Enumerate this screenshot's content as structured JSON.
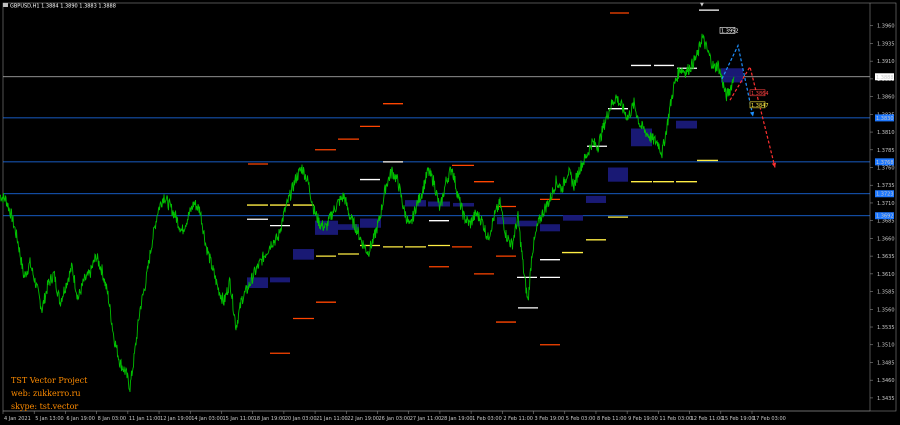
{
  "header": {
    "text": "GBPUSD,H1  1.3884 1.3890 1.3883 1.3888"
  },
  "promo": {
    "line1": "TST Vector Project",
    "line2": "web: zukkerro.ru",
    "line3": "skype: tst.vector"
  },
  "colors": {
    "background": "#000000",
    "price": "#00c000",
    "levelBlue": "#1e78ff",
    "levelGray": "#c0c0c0",
    "zone": "#1a1a7a",
    "marker_white": "#ffffff",
    "marker_red": "#ff4500",
    "marker_yellow": "#ffee44",
    "arrowBlue": "#1e90ff",
    "arrowRed": "#ff3030"
  },
  "chart_data": {
    "type": "line",
    "title": "",
    "symbol": "GBPUSD",
    "timeframe": "H1",
    "ylim": [
      1.3425,
      1.3985
    ],
    "yticks": [
      "1.3960",
      "1.3935",
      "1.3910",
      "1.3885",
      "1.3860",
      "1.3835",
      "1.3810",
      "1.3785",
      "1.3760",
      "1.3735",
      "1.3710",
      "1.3685",
      "1.3660",
      "1.3635",
      "1.3610",
      "1.3585",
      "1.3560",
      "1.3535",
      "1.3510",
      "1.3485",
      "1.3460",
      "1.3435"
    ],
    "xticks": [
      "4 Jan 2021",
      "5 Jan 13:00",
      "6 Jan 19:00",
      "8 Jan 03:00",
      "11 Jan 11:00",
      "12 Jan 19:00",
      "14 Jan 03:00",
      "15 Jan 11:00",
      "18 Jan 19:00",
      "20 Jan 03:00",
      "21 Jan 11:00",
      "22 Jan 19:00",
      "26 Jan 03:00",
      "27 Jan 11:00",
      "28 Jan 19:00",
      "1 Feb 03:00",
      "2 Feb 11:00",
      "3 Feb 19:00",
      "5 Feb 03:00",
      "8 Feb 11:00",
      "9 Feb 19:00",
      "11 Feb 03:00",
      "12 Feb 11:00",
      "15 Feb 19:00",
      "17 Feb 03:00"
    ],
    "current_price": "1.3888",
    "price_labels": [
      {
        "value": "1.3830",
        "kind": "blue"
      },
      {
        "value": "1.3768",
        "kind": "blue"
      },
      {
        "value": "1.3723",
        "kind": "blue"
      },
      {
        "value": "1.3692",
        "kind": "blue"
      }
    ],
    "horizontal_levels": [
      {
        "price": 1.3888,
        "kind": "gray"
      },
      {
        "price": 1.383,
        "kind": "blue"
      },
      {
        "price": 1.3768,
        "kind": "blue"
      },
      {
        "price": 1.3723,
        "kind": "blue"
      },
      {
        "price": 1.3692,
        "kind": "blue"
      }
    ],
    "box_labels": [
      "1.3952",
      "1.3864",
      "1.3847"
    ],
    "series": [
      {
        "name": "",
        "keypoints": [
          [
            0,
            1.372
          ],
          [
            6,
            1.3715
          ],
          [
            12,
            1.369
          ],
          [
            18,
            1.3655
          ],
          [
            24,
            1.3605
          ],
          [
            30,
            1.3625
          ],
          [
            36,
            1.3595
          ],
          [
            42,
            1.356
          ],
          [
            48,
            1.3595
          ],
          [
            54,
            1.361
          ],
          [
            60,
            1.357
          ],
          [
            66,
            1.3595
          ],
          [
            72,
            1.362
          ],
          [
            78,
            1.3575
          ],
          [
            84,
            1.36
          ],
          [
            90,
            1.361
          ],
          [
            96,
            1.3635
          ],
          [
            102,
            1.3615
          ],
          [
            108,
            1.358
          ],
          [
            114,
            1.352
          ],
          [
            120,
            1.3485
          ],
          [
            126,
            1.347
          ],
          [
            130,
            1.345
          ],
          [
            134,
            1.349
          ],
          [
            140,
            1.356
          ],
          [
            146,
            1.36
          ],
          [
            152,
            1.3655
          ],
          [
            158,
            1.37
          ],
          [
            164,
            1.372
          ],
          [
            170,
            1.3705
          ],
          [
            176,
            1.369
          ],
          [
            182,
            1.367
          ],
          [
            188,
            1.369
          ],
          [
            194,
            1.371
          ],
          [
            200,
            1.37
          ],
          [
            206,
            1.365
          ],
          [
            212,
            1.362
          ],
          [
            218,
            1.359
          ],
          [
            224,
            1.357
          ],
          [
            230,
            1.36
          ],
          [
            236,
            1.3535
          ],
          [
            242,
            1.3575
          ],
          [
            248,
            1.359
          ],
          [
            254,
            1.361
          ],
          [
            260,
            1.3625
          ],
          [
            266,
            1.364
          ],
          [
            272,
            1.3655
          ],
          [
            278,
            1.366
          ],
          [
            284,
            1.3695
          ],
          [
            290,
            1.372
          ],
          [
            296,
            1.3745
          ],
          [
            302,
            1.376
          ],
          [
            308,
            1.374
          ],
          [
            314,
            1.37
          ],
          [
            320,
            1.368
          ],
          [
            326,
            1.3675
          ],
          [
            332,
            1.3695
          ],
          [
            338,
            1.371
          ],
          [
            344,
            1.372
          ],
          [
            350,
            1.369
          ],
          [
            356,
            1.3675
          ],
          [
            362,
            1.3655
          ],
          [
            368,
            1.364
          ],
          [
            374,
            1.366
          ],
          [
            380,
            1.369
          ],
          [
            386,
            1.3735
          ],
          [
            392,
            1.3755
          ],
          [
            398,
            1.374
          ],
          [
            404,
            1.37
          ],
          [
            410,
            1.3675
          ],
          [
            416,
            1.3705
          ],
          [
            422,
            1.3725
          ],
          [
            428,
            1.3755
          ],
          [
            434,
            1.374
          ],
          [
            440,
            1.37
          ],
          [
            446,
            1.374
          ],
          [
            452,
            1.376
          ],
          [
            458,
            1.372
          ],
          [
            464,
            1.369
          ],
          [
            470,
            1.368
          ],
          [
            476,
            1.3695
          ],
          [
            482,
            1.3685
          ],
          [
            488,
            1.366
          ],
          [
            494,
            1.369
          ],
          [
            500,
            1.371
          ],
          [
            506,
            1.3665
          ],
          [
            512,
            1.365
          ],
          [
            518,
            1.369
          ],
          [
            524,
            1.361
          ],
          [
            528,
            1.357
          ],
          [
            532,
            1.364
          ],
          [
            538,
            1.368
          ],
          [
            544,
            1.37
          ],
          [
            550,
            1.3715
          ],
          [
            556,
            1.374
          ],
          [
            562,
            1.373
          ],
          [
            568,
            1.3755
          ],
          [
            574,
            1.3735
          ],
          [
            580,
            1.376
          ],
          [
            586,
            1.3775
          ],
          [
            592,
            1.3795
          ],
          [
            598,
            1.379
          ],
          [
            604,
            1.382
          ],
          [
            610,
            1.3845
          ],
          [
            616,
            1.386
          ],
          [
            622,
            1.3845
          ],
          [
            628,
            1.383
          ],
          [
            634,
            1.385
          ],
          [
            640,
            1.382
          ],
          [
            646,
            1.381
          ],
          [
            652,
            1.38
          ],
          [
            658,
            1.3795
          ],
          [
            662,
            1.378
          ],
          [
            666,
            1.381
          ],
          [
            670,
            1.3845
          ],
          [
            674,
            1.3875
          ],
          [
            680,
            1.39
          ],
          [
            686,
            1.3895
          ],
          [
            692,
            1.3905
          ],
          [
            698,
            1.392
          ],
          [
            702,
            1.3945
          ],
          [
            706,
            1.393
          ],
          [
            710,
            1.3915
          ],
          [
            714,
            1.39
          ],
          [
            718,
            1.3905
          ],
          [
            722,
            1.3885
          ],
          [
            726,
            1.386
          ],
          [
            730,
            1.387
          ],
          [
            734,
            1.3888
          ]
        ]
      }
    ],
    "zones": [
      {
        "x1": 247,
        "x2": 268,
        "p1": 1.3605,
        "p2": 1.359
      },
      {
        "x1": 270,
        "x2": 290,
        "p1": 1.3605,
        "p2": 1.3598
      },
      {
        "x1": 293,
        "x2": 314,
        "p1": 1.3645,
        "p2": 1.363
      },
      {
        "x1": 315,
        "x2": 338,
        "p1": 1.3685,
        "p2": 1.3665
      },
      {
        "x1": 338,
        "x2": 359,
        "p1": 1.368,
        "p2": 1.3672
      },
      {
        "x1": 360,
        "x2": 381,
        "p1": 1.3688,
        "p2": 1.3675
      },
      {
        "x1": 405,
        "x2": 426,
        "p1": 1.3714,
        "p2": 1.3705
      },
      {
        "x1": 428,
        "x2": 450,
        "p1": 1.3712,
        "p2": 1.3705
      },
      {
        "x1": 453,
        "x2": 474,
        "p1": 1.371,
        "p2": 1.3705
      },
      {
        "x1": 497,
        "x2": 516,
        "p1": 1.369,
        "p2": 1.368
      },
      {
        "x1": 517,
        "x2": 537,
        "p1": 1.3685,
        "p2": 1.3677
      },
      {
        "x1": 540,
        "x2": 560,
        "p1": 1.368,
        "p2": 1.367
      },
      {
        "x1": 563,
        "x2": 583,
        "p1": 1.3693,
        "p2": 1.3685
      },
      {
        "x1": 586,
        "x2": 606,
        "p1": 1.372,
        "p2": 1.371
      },
      {
        "x1": 608,
        "x2": 628,
        "p1": 1.376,
        "p2": 1.374
      },
      {
        "x1": 631,
        "x2": 652,
        "p1": 1.3815,
        "p2": 1.379
      },
      {
        "x1": 676,
        "x2": 697,
        "p1": 1.3826,
        "p2": 1.3815
      },
      {
        "x1": 721,
        "x2": 743,
        "p1": 1.39,
        "p2": 1.388
      }
    ],
    "markers": [
      {
        "x1": 610,
        "x2": 629,
        "p": 1.3978,
        "c": "red"
      },
      {
        "x1": 699,
        "x2": 719,
        "p": 1.3982,
        "c": "white"
      },
      {
        "x1": 631,
        "x2": 651,
        "p": 1.3904,
        "c": "white"
      },
      {
        "x1": 654,
        "x2": 674,
        "p": 1.3904,
        "c": "white"
      },
      {
        "x1": 677,
        "x2": 697,
        "p": 1.39,
        "c": "white"
      },
      {
        "x1": 587,
        "x2": 607,
        "p": 1.379,
        "c": "white"
      },
      {
        "x1": 608,
        "x2": 628,
        "p": 1.3843,
        "c": "white"
      },
      {
        "x1": 676,
        "x2": 697,
        "p": 1.374,
        "c": "yellow"
      },
      {
        "x1": 653,
        "x2": 674,
        "p": 1.374,
        "c": "yellow"
      },
      {
        "x1": 631,
        "x2": 652,
        "p": 1.374,
        "c": "yellow"
      },
      {
        "x1": 697,
        "x2": 718,
        "p": 1.377,
        "c": "yellow"
      },
      {
        "x1": 608,
        "x2": 628,
        "p": 1.369,
        "c": "yellow"
      },
      {
        "x1": 586,
        "x2": 606,
        "p": 1.3658,
        "c": "yellow"
      },
      {
        "x1": 562,
        "x2": 583,
        "p": 1.364,
        "c": "yellow"
      },
      {
        "x1": 540,
        "x2": 560,
        "p": 1.363,
        "c": "white"
      },
      {
        "x1": 540,
        "x2": 560,
        "p": 1.3605,
        "c": "white"
      },
      {
        "x1": 517,
        "x2": 537,
        "p": 1.3605,
        "c": "white"
      },
      {
        "x1": 383,
        "x2": 403,
        "p": 1.385,
        "c": "red"
      },
      {
        "x1": 360,
        "x2": 380,
        "p": 1.3818,
        "c": "red"
      },
      {
        "x1": 338,
        "x2": 359,
        "p": 1.38,
        "c": "red"
      },
      {
        "x1": 315,
        "x2": 336,
        "p": 1.3785,
        "c": "red"
      },
      {
        "x1": 248,
        "x2": 268,
        "p": 1.3765,
        "c": "red"
      },
      {
        "x1": 383,
        "x2": 403,
        "p": 1.3768,
        "c": "white"
      },
      {
        "x1": 452,
        "x2": 474,
        "p": 1.3763,
        "c": "red"
      },
      {
        "x1": 360,
        "x2": 380,
        "p": 1.3743,
        "c": "white"
      },
      {
        "x1": 474,
        "x2": 494,
        "p": 1.374,
        "c": "red"
      },
      {
        "x1": 496,
        "x2": 516,
        "p": 1.3705,
        "c": "red"
      },
      {
        "x1": 540,
        "x2": 560,
        "p": 1.3715,
        "c": "red"
      },
      {
        "x1": 247,
        "x2": 268,
        "p": 1.3707,
        "c": "yellow"
      },
      {
        "x1": 270,
        "x2": 290,
        "p": 1.3707,
        "c": "yellow"
      },
      {
        "x1": 293,
        "x2": 314,
        "p": 1.3707,
        "c": "yellow"
      },
      {
        "x1": 247,
        "x2": 268,
        "p": 1.3687,
        "c": "white"
      },
      {
        "x1": 270,
        "x2": 290,
        "p": 1.3678,
        "c": "white"
      },
      {
        "x1": 316,
        "x2": 336,
        "p": 1.3635,
        "c": "yellow"
      },
      {
        "x1": 338,
        "x2": 359,
        "p": 1.3638,
        "c": "yellow"
      },
      {
        "x1": 383,
        "x2": 403,
        "p": 1.3648,
        "c": "yellow"
      },
      {
        "x1": 405,
        "x2": 426,
        "p": 1.3648,
        "c": "yellow"
      },
      {
        "x1": 428,
        "x2": 450,
        "p": 1.365,
        "c": "yellow"
      },
      {
        "x1": 360,
        "x2": 380,
        "p": 1.365,
        "c": "yellow"
      },
      {
        "x1": 429,
        "x2": 449,
        "p": 1.3685,
        "c": "white"
      },
      {
        "x1": 452,
        "x2": 472,
        "p": 1.3648,
        "c": "red"
      },
      {
        "x1": 429,
        "x2": 449,
        "p": 1.362,
        "c": "red"
      },
      {
        "x1": 474,
        "x2": 494,
        "p": 1.361,
        "c": "red"
      },
      {
        "x1": 496,
        "x2": 516,
        "p": 1.3635,
        "c": "red"
      },
      {
        "x1": 316,
        "x2": 336,
        "p": 1.357,
        "c": "red"
      },
      {
        "x1": 293,
        "x2": 314,
        "p": 1.3547,
        "c": "red"
      },
      {
        "x1": 270,
        "x2": 290,
        "p": 1.3498,
        "c": "red"
      },
      {
        "x1": 496,
        "x2": 516,
        "p": 1.3542,
        "c": "red"
      },
      {
        "x1": 518,
        "x2": 538,
        "p": 1.3562,
        "c": "white"
      },
      {
        "x1": 540,
        "x2": 560,
        "p": 1.351,
        "c": "red"
      }
    ],
    "arrows": [
      {
        "color": "blue",
        "pts": [
          [
            722,
            1.3885
          ],
          [
            738,
            1.3932
          ],
          [
            753,
            1.3832
          ]
        ]
      },
      {
        "color": "red",
        "pts": [
          [
            730,
            1.3855
          ],
          [
            750,
            1.3902
          ],
          [
            775,
            1.376
          ]
        ]
      }
    ]
  }
}
